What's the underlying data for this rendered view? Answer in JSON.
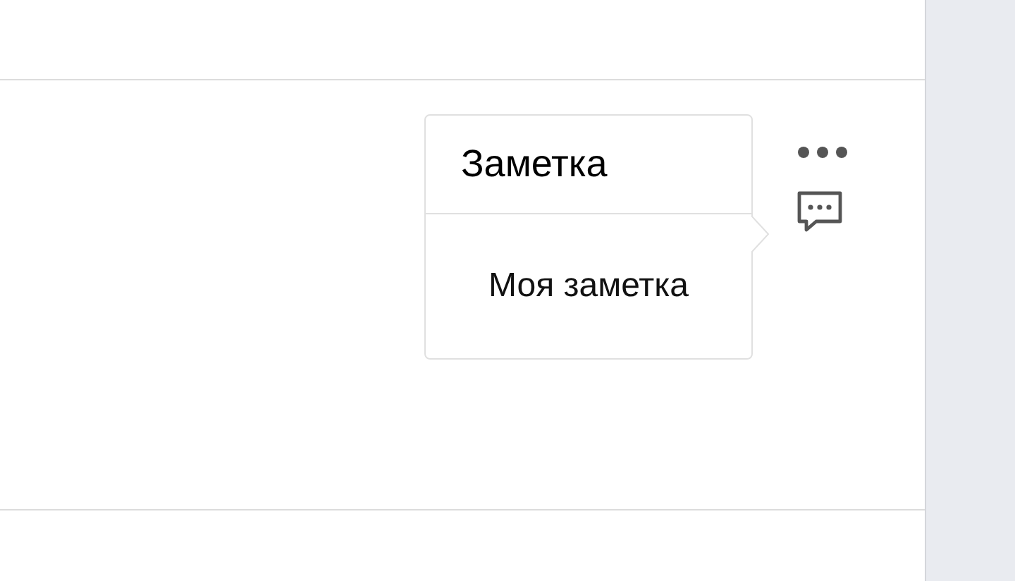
{
  "note_popover": {
    "title": "Заметка",
    "body": "Моя заметка"
  }
}
